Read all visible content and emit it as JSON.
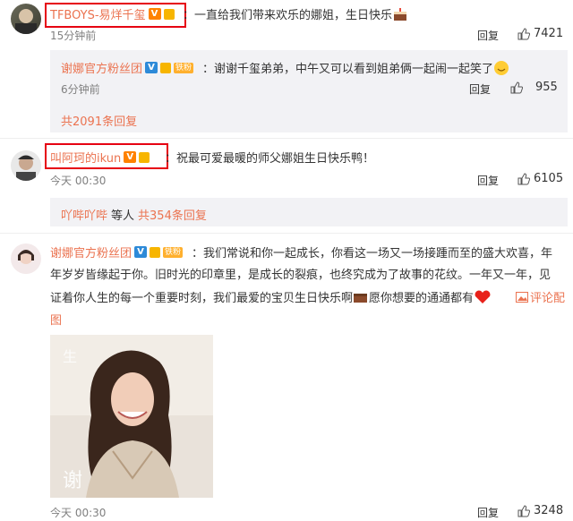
{
  "comment1": {
    "name": "TFBOYS-易烊千玺",
    "text": "：一直给我们带来欢乐的娜姐，生日快乐",
    "time": "15分钟前",
    "reply_label": "回复",
    "likes": "7421"
  },
  "subreply": {
    "name": "谢娜官方粉丝团",
    "fan_badge": "铁粉",
    "text": "：谢谢千玺弟弟，中午又可以看到姐弟俩一起闹一起笑了",
    "time": "6分钟前",
    "reply_label": "回复",
    "likes": "955",
    "more": "共2091条回复"
  },
  "comment2": {
    "name": "叫阿珂的ikun",
    "text": "：祝最可爱最暖的师父娜姐生日快乐鸭！",
    "time": "今天 00:30",
    "reply_label": "回复",
    "likes": "6105",
    "replies_user": "吖哔吖哔",
    "replies_mid": "等人",
    "replies_count": "共354条回复"
  },
  "comment3": {
    "name": "谢娜官方粉丝团",
    "fan_badge": "铁粉",
    "text_line1": "：我们常说和你一起成长，你看这一场又一场接踵而至的盛大欢喜，年",
    "text_line2": "年岁岁皆缘起于你。旧时光的印章里，是成长的裂痕，也终究成为了故事的花纹。一年又一年，见",
    "text_line3": "证着你人生的每一个重要时刻，我们最爱的宝贝生日快乐啊",
    "text_line3b": "愿你想要的通通都有",
    "comment_pic_link": "评论配",
    "comment_pic_link2": "图",
    "time": "今天 00:30",
    "reply_label": "回复",
    "likes": "3248"
  },
  "colors": {
    "name": "#eb7350",
    "highlight": "#e60012",
    "reply_bg": "#f2f2f5"
  }
}
